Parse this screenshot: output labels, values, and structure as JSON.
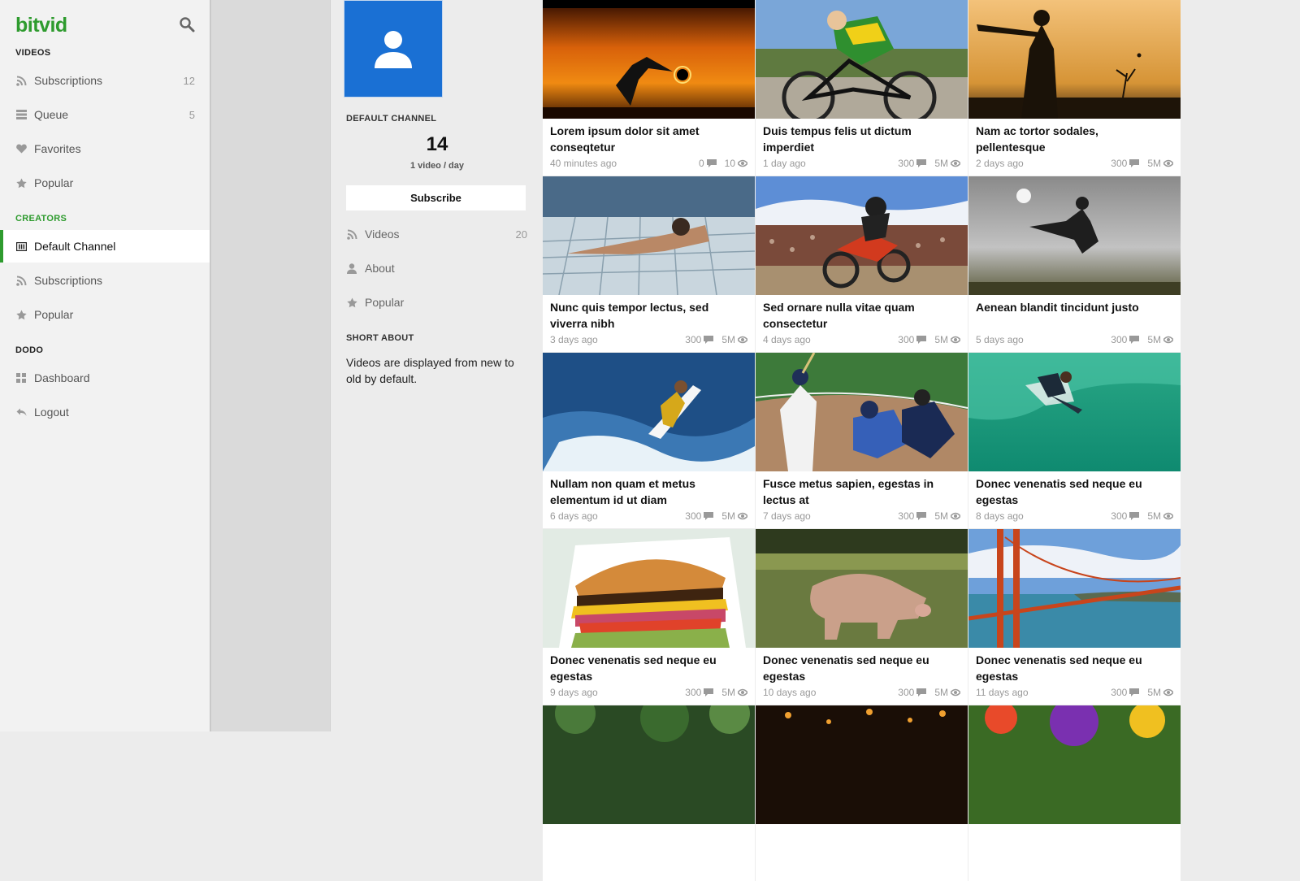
{
  "app": {
    "logo": "bitvid"
  },
  "colors": {
    "brand": "#2e9b2e",
    "avatar": "#1a70d4"
  },
  "sidebar": {
    "sections": [
      {
        "title": "VIDEOS",
        "green": false,
        "items": [
          {
            "label": "Subscriptions",
            "icon": "rss-icon",
            "count": "12"
          },
          {
            "label": "Queue",
            "icon": "list-icon",
            "count": "5"
          },
          {
            "label": "Favorites",
            "icon": "heart-icon",
            "count": ""
          },
          {
            "label": "Popular",
            "icon": "star-icon",
            "count": ""
          }
        ]
      },
      {
        "title": "CREATORS",
        "green": true,
        "items": [
          {
            "label": "Default Channel",
            "icon": "channel-icon",
            "count": "",
            "active": true
          },
          {
            "label": "Subscriptions",
            "icon": "rss-icon",
            "count": ""
          },
          {
            "label": "Popular",
            "icon": "star-icon",
            "count": ""
          }
        ]
      },
      {
        "title": "DODO",
        "green": false,
        "items": [
          {
            "label": "Dashboard",
            "icon": "dashboard-icon",
            "count": ""
          },
          {
            "label": "Logout",
            "icon": "reply-icon",
            "count": ""
          }
        ]
      }
    ]
  },
  "channel": {
    "label": "DEFAULT CHANNEL",
    "stat_value": "14",
    "stat_label": "1 video / day",
    "subscribe_label": "Subscribe",
    "nav": [
      {
        "label": "Videos",
        "icon": "rss-icon",
        "count": "20"
      },
      {
        "label": "About",
        "icon": "user-icon",
        "count": ""
      },
      {
        "label": "Popular",
        "icon": "star-icon",
        "count": ""
      }
    ],
    "about_title": "SHORT ABOUT",
    "about_text": "Videos are displayed from new to old by default."
  },
  "videos": [
    {
      "title": "Lorem ipsum dolor sit amet conseqtetur",
      "time": "40 minutes ago",
      "comments": "0",
      "views": "10",
      "thumb": "sunset-kick"
    },
    {
      "title": "Duis tempus felis ut dictum imperdiet",
      "time": "1 day ago",
      "comments": "300",
      "views": "5M",
      "thumb": "cyclist"
    },
    {
      "title": "Nam ac tortor sodales, pellentesque",
      "time": "2 days ago",
      "comments": "300",
      "views": "5M",
      "thumb": "cricket"
    },
    {
      "title": "Nunc quis tempor lectus, sed viverra nibh",
      "time": "3 days ago",
      "comments": "300",
      "views": "5M",
      "thumb": "swimmer"
    },
    {
      "title": "Sed ornare nulla vitae quam consectetur",
      "time": "4 days ago",
      "comments": "300",
      "views": "5M",
      "thumb": "motocross"
    },
    {
      "title": "Aenean blandit tincidunt justo",
      "time": "5 days ago",
      "comments": "300",
      "views": "5M",
      "thumb": "martial-jump"
    },
    {
      "title": "Nullam non quam et metus elementum id ut diam",
      "time": "6 days ago",
      "comments": "300",
      "views": "5M",
      "thumb": "surfer"
    },
    {
      "title": "Fusce metus sapien, egestas in lectus at",
      "time": "7 days ago",
      "comments": "300",
      "views": "5M",
      "thumb": "baseball"
    },
    {
      "title": "Donec venenatis sed neque eu egestas",
      "time": "8 days ago",
      "comments": "300",
      "views": "5M",
      "thumb": "wave-surfer"
    },
    {
      "title": "Donec venenatis sed neque eu egestas",
      "time": "9 days ago",
      "comments": "300",
      "views": "5M",
      "thumb": "burger"
    },
    {
      "title": "Donec venenatis sed neque eu egestas",
      "time": "10 days ago",
      "comments": "300",
      "views": "5M",
      "thumb": "pig"
    },
    {
      "title": "Donec venenatis sed neque eu egestas",
      "time": "11 days ago",
      "comments": "300",
      "views": "5M",
      "thumb": "golden-gate"
    },
    {
      "title": "",
      "time": "",
      "comments": "",
      "views": "",
      "thumb": "forest"
    },
    {
      "title": "",
      "time": "",
      "comments": "",
      "views": "",
      "thumb": "night-city"
    },
    {
      "title": "",
      "time": "",
      "comments": "",
      "views": "",
      "thumb": "flowers"
    }
  ]
}
